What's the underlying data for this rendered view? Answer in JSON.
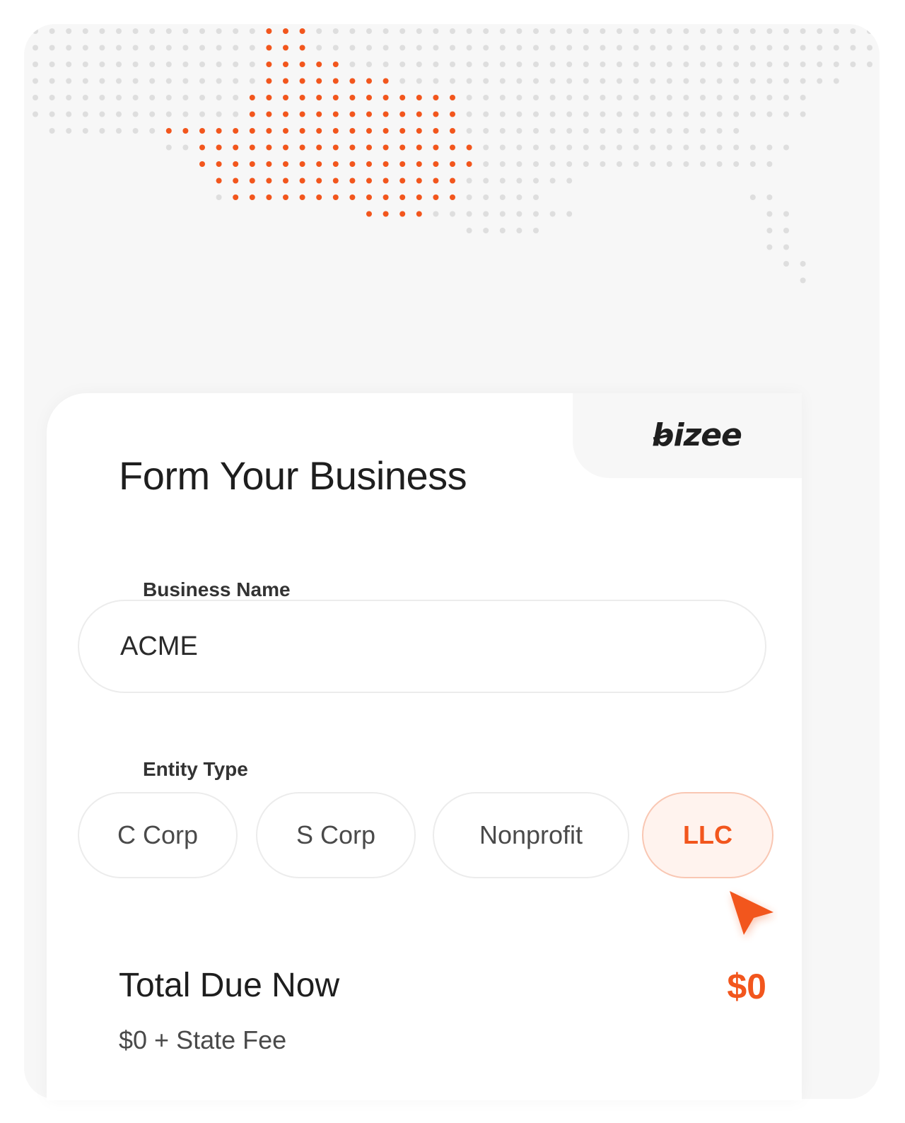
{
  "brand": {
    "logo_text": "bizee",
    "accent_color": "#f2561d"
  },
  "form": {
    "title": "Form Your Business",
    "business_name_label": "Business Name",
    "business_name_value": "ACME",
    "entity_type_label": "Entity Type",
    "entity_options": [
      "C Corp",
      "S Corp",
      "Nonprofit",
      "LLC"
    ],
    "selected_entity": "LLC"
  },
  "summary": {
    "total_label": "Total Due Now",
    "total_value": "$0",
    "breakdown": "$0 + State Fee"
  },
  "icons": {
    "map": "us-dot-map-icon",
    "cursor": "pointer-cursor-icon"
  }
}
